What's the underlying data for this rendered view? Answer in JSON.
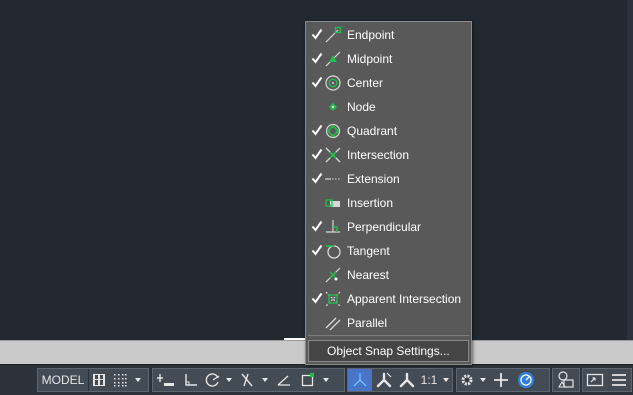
{
  "menu": {
    "items": [
      {
        "label": "Endpoint",
        "checked": true,
        "icon": "endpoint-osnap-icon"
      },
      {
        "label": "Midpoint",
        "checked": true,
        "icon": "midpoint-osnap-icon"
      },
      {
        "label": "Center",
        "checked": true,
        "icon": "center-osnap-icon"
      },
      {
        "label": "Node",
        "checked": false,
        "icon": "node-osnap-icon"
      },
      {
        "label": "Quadrant",
        "checked": true,
        "icon": "quadrant-osnap-icon"
      },
      {
        "label": "Intersection",
        "checked": true,
        "icon": "intersection-osnap-icon"
      },
      {
        "label": "Extension",
        "checked": true,
        "icon": "extension-osnap-icon"
      },
      {
        "label": "Insertion",
        "checked": false,
        "icon": "insertion-osnap-icon"
      },
      {
        "label": "Perpendicular",
        "checked": true,
        "icon": "perpendicular-osnap-icon"
      },
      {
        "label": "Tangent",
        "checked": true,
        "icon": "tangent-osnap-icon"
      },
      {
        "label": "Nearest",
        "checked": false,
        "icon": "nearest-osnap-icon"
      },
      {
        "label": "Apparent Intersection",
        "checked": true,
        "icon": "apparent-intersection-osnap-icon"
      },
      {
        "label": "Parallel",
        "checked": false,
        "icon": "parallel-osnap-icon"
      }
    ],
    "settings_label": "Object Snap Settings..."
  },
  "statusbar": {
    "model_label": "MODEL",
    "scale_label": "1:1",
    "buttons": [
      "grid-icon",
      "snap-mode-icon",
      "infer-constraints-icon",
      "ortho-icon",
      "polar-tracking-icon",
      "isodraft-icon",
      "object-snap-tracking-icon",
      "object-snap-icon",
      "annotation-visibility-icon",
      "auto-scale-icon",
      "annotation-scale-icon",
      "workspace-gear-icon",
      "plus-icon",
      "isolate-objects-icon",
      "graphics-performance-icon",
      "clean-screen-icon",
      "customization-menu-icon"
    ]
  },
  "colors": {
    "canvas": "#212830",
    "menu_bg": "#59595a",
    "snap_green": "#1fbf4a",
    "active_blue": "#2f7fe0"
  }
}
